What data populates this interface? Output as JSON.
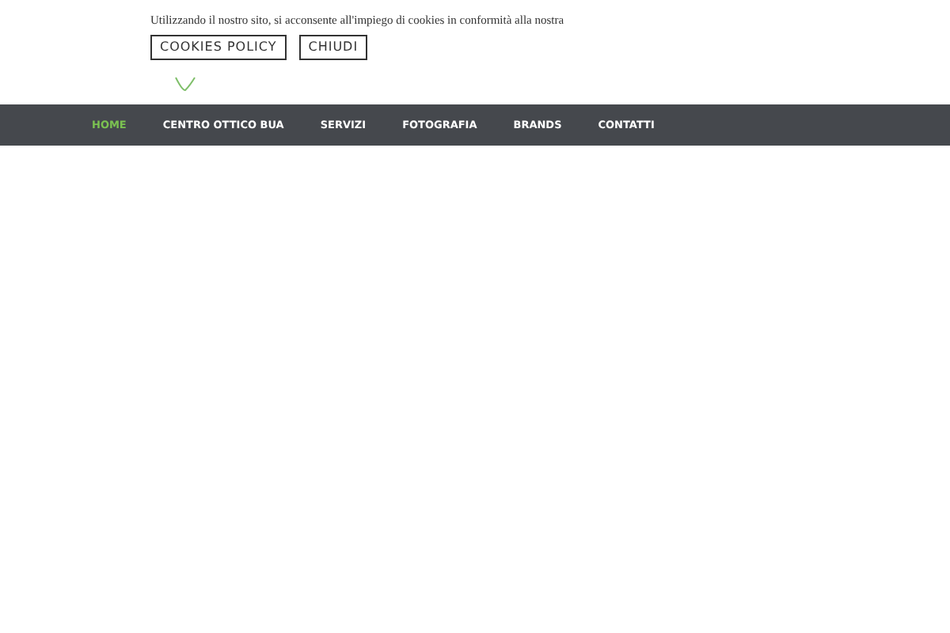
{
  "cookie_banner": {
    "message": "Utilizzando il nostro sito, si acconsente all'impiego di cookies in conformità alla nostra",
    "buttons": [
      "COOKIES POLICY",
      "CHIUDI"
    ]
  },
  "nav": [
    {
      "label": "HOME",
      "selected": true
    },
    {
      "label": "CENTRO OTTICO BUA",
      "selected": false
    },
    {
      "label": "SERVIZI",
      "selected": false
    },
    {
      "label": "FOTOGRAFIA",
      "selected": false
    },
    {
      "label": "BRANDS",
      "selected": false
    },
    {
      "label": "CONTATTI",
      "selected": false
    }
  ]
}
